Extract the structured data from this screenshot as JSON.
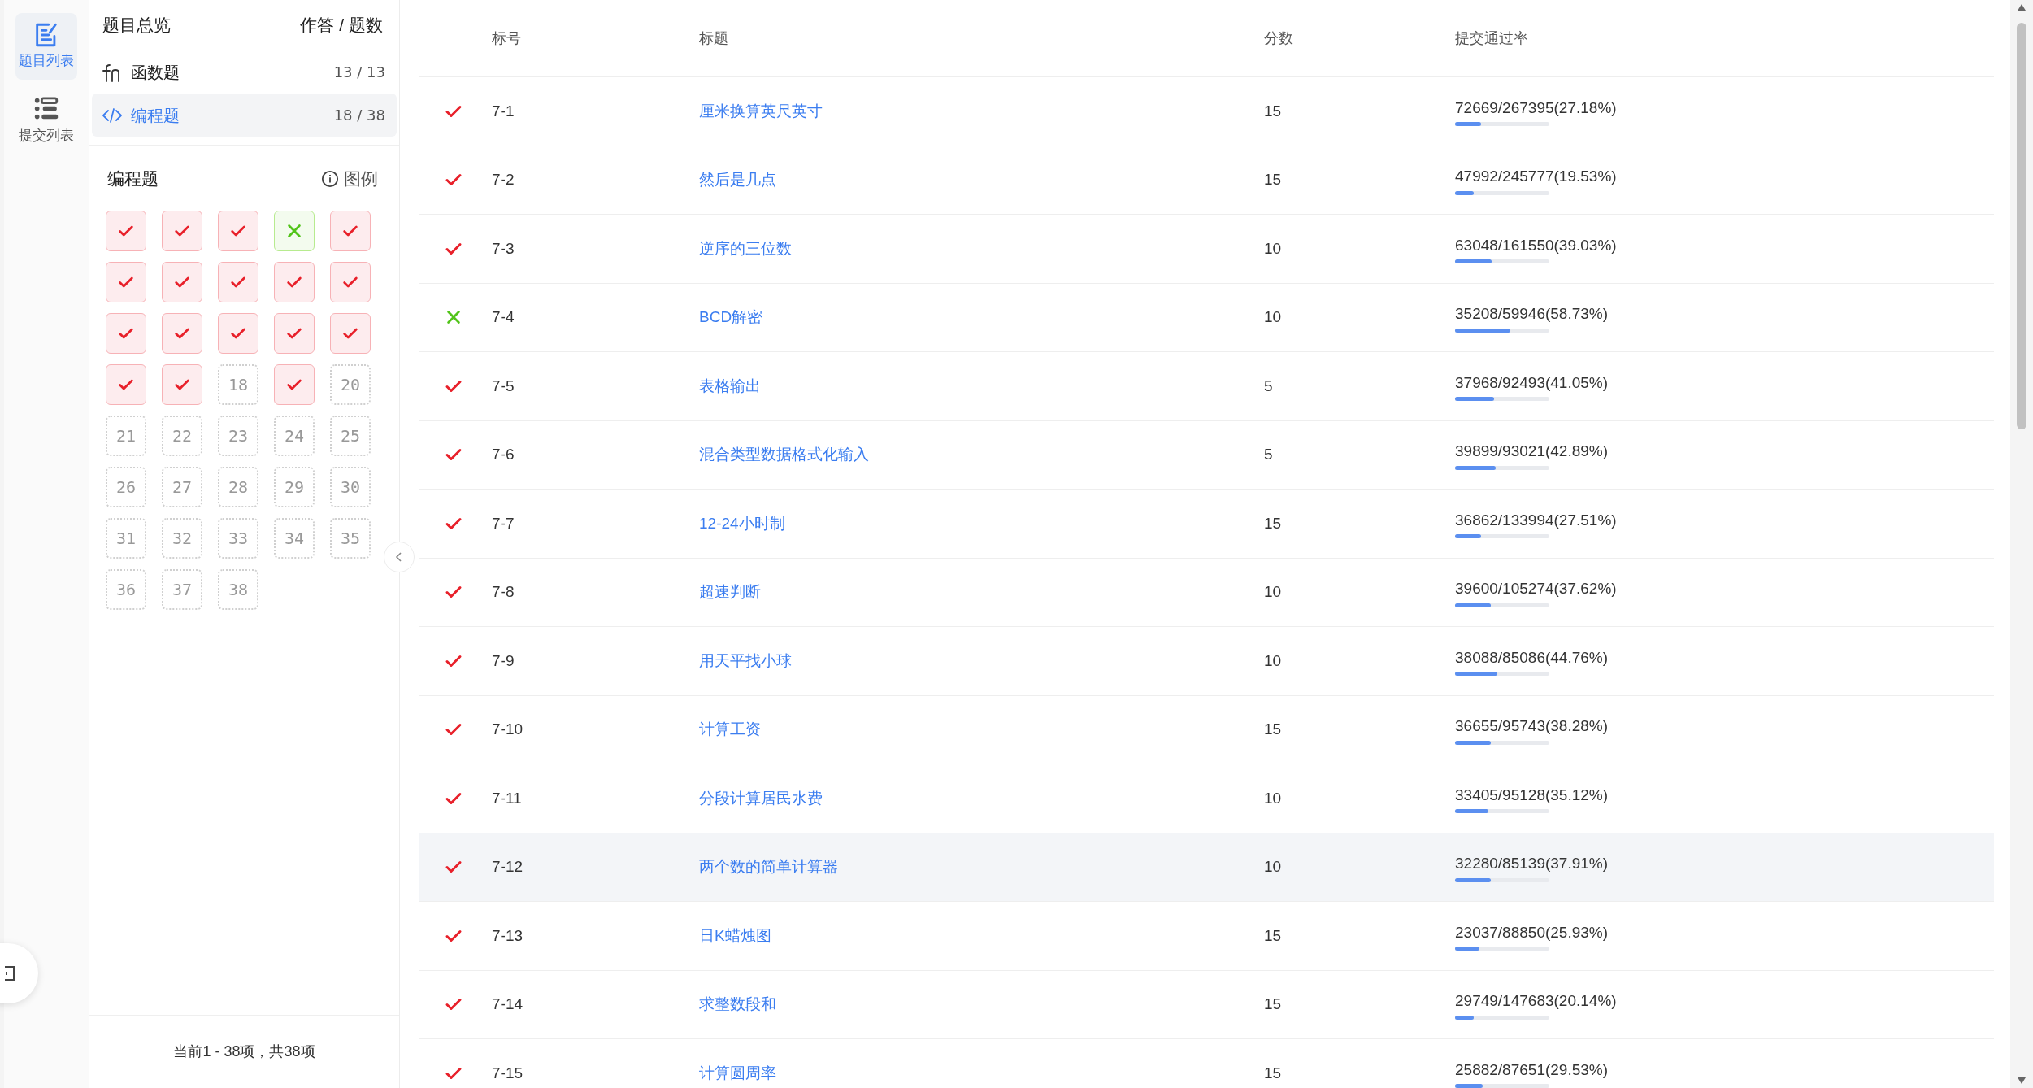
{
  "nav": [
    {
      "label": "题目列表",
      "kind": "edit",
      "selected": true
    },
    {
      "label": "提交列表",
      "kind": "list",
      "selected": false
    }
  ],
  "overview": {
    "title": "题目总览",
    "count_header": "作答 / 题数",
    "categories": [
      {
        "kind": "fn",
        "label": "函数题",
        "count": "13 / 13",
        "selected": false
      },
      {
        "kind": "code",
        "label": "编程题",
        "count": "18 / 38",
        "selected": true
      }
    ]
  },
  "grid": {
    "title": "编程题",
    "legend": "图例",
    "cells": [
      {
        "kind": "pass"
      },
      {
        "kind": "pass"
      },
      {
        "kind": "pass"
      },
      {
        "kind": "fail"
      },
      {
        "kind": "pass"
      },
      {
        "kind": "pass"
      },
      {
        "kind": "pass"
      },
      {
        "kind": "pass"
      },
      {
        "kind": "pass"
      },
      {
        "kind": "pass"
      },
      {
        "kind": "pass"
      },
      {
        "kind": "pass"
      },
      {
        "kind": "pass"
      },
      {
        "kind": "pass"
      },
      {
        "kind": "pass"
      },
      {
        "kind": "pass"
      },
      {
        "kind": "pass"
      },
      {
        "kind": "none",
        "label": "18"
      },
      {
        "kind": "pass"
      },
      {
        "kind": "none",
        "label": "20"
      },
      {
        "kind": "none",
        "label": "21"
      },
      {
        "kind": "none",
        "label": "22"
      },
      {
        "kind": "none",
        "label": "23"
      },
      {
        "kind": "none",
        "label": "24"
      },
      {
        "kind": "none",
        "label": "25"
      },
      {
        "kind": "none",
        "label": "26"
      },
      {
        "kind": "none",
        "label": "27"
      },
      {
        "kind": "none",
        "label": "28"
      },
      {
        "kind": "none",
        "label": "29"
      },
      {
        "kind": "none",
        "label": "30"
      },
      {
        "kind": "none",
        "label": "31"
      },
      {
        "kind": "none",
        "label": "32"
      },
      {
        "kind": "none",
        "label": "33"
      },
      {
        "kind": "none",
        "label": "34"
      },
      {
        "kind": "none",
        "label": "35"
      },
      {
        "kind": "none",
        "label": "36"
      },
      {
        "kind": "none",
        "label": "37"
      },
      {
        "kind": "none",
        "label": "38"
      }
    ]
  },
  "pagination": "当前1 - 38项，共38项",
  "table": {
    "columns": [
      "标号",
      "标题",
      "分数",
      "提交通过率"
    ],
    "rows": [
      {
        "kind": "pass",
        "id": "7-1",
        "title": "厘米换算英尺英寸",
        "score": "15",
        "rate": "72669/267395(27.18%)",
        "level": 0.2718,
        "highlighted": false
      },
      {
        "kind": "pass",
        "id": "7-2",
        "title": "然后是几点",
        "score": "15",
        "rate": "47992/245777(19.53%)",
        "level": 0.1953,
        "highlighted": false
      },
      {
        "kind": "pass",
        "id": "7-3",
        "title": "逆序的三位数",
        "score": "10",
        "rate": "63048/161550(39.03%)",
        "level": 0.3903,
        "highlighted": false
      },
      {
        "kind": "fail",
        "id": "7-4",
        "title": "BCD解密",
        "score": "10",
        "rate": "35208/59946(58.73%)",
        "level": 0.5873,
        "highlighted": false
      },
      {
        "kind": "pass",
        "id": "7-5",
        "title": "表格输出",
        "score": "5",
        "rate": "37968/92493(41.05%)",
        "level": 0.4105,
        "highlighted": false
      },
      {
        "kind": "pass",
        "id": "7-6",
        "title": "混合类型数据格式化输入",
        "score": "5",
        "rate": "39899/93021(42.89%)",
        "level": 0.4289,
        "highlighted": false
      },
      {
        "kind": "pass",
        "id": "7-7",
        "title": "12-24小时制",
        "score": "15",
        "rate": "36862/133994(27.51%)",
        "level": 0.2751,
        "highlighted": false
      },
      {
        "kind": "pass",
        "id": "7-8",
        "title": "超速判断",
        "score": "10",
        "rate": "39600/105274(37.62%)",
        "level": 0.3762,
        "highlighted": false
      },
      {
        "kind": "pass",
        "id": "7-9",
        "title": "用天平找小球",
        "score": "10",
        "rate": "38088/85086(44.76%)",
        "level": 0.4476,
        "highlighted": false
      },
      {
        "kind": "pass",
        "id": "7-10",
        "title": "计算工资",
        "score": "15",
        "rate": "36655/95743(38.28%)",
        "level": 0.3828,
        "highlighted": false
      },
      {
        "kind": "pass",
        "id": "7-11",
        "title": "分段计算居民水费",
        "score": "10",
        "rate": "33405/95128(35.12%)",
        "level": 0.3512,
        "highlighted": false
      },
      {
        "kind": "pass",
        "id": "7-12",
        "title": "两个数的简单计算器",
        "score": "10",
        "rate": "32280/85139(37.91%)",
        "level": 0.3791,
        "highlighted": true
      },
      {
        "kind": "pass",
        "id": "7-13",
        "title": "日K蜡烛图",
        "score": "15",
        "rate": "23037/88850(25.93%)",
        "level": 0.2593,
        "highlighted": false
      },
      {
        "kind": "pass",
        "id": "7-14",
        "title": "求整数段和",
        "score": "15",
        "rate": "29749/147683(20.14%)",
        "level": 0.2014,
        "highlighted": false
      },
      {
        "kind": "pass",
        "id": "7-15",
        "title": "计算圆周率",
        "score": "15",
        "rate": "25882/87651(29.53%)",
        "level": 0.2953,
        "highlighted": false
      }
    ]
  }
}
